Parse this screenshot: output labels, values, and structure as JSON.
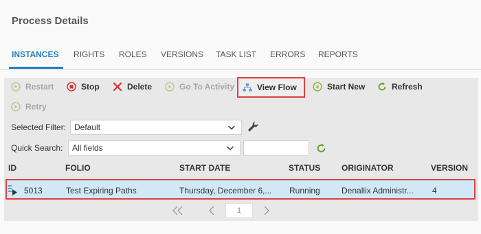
{
  "header": {
    "title": "Process Details"
  },
  "tabs": [
    {
      "label": "INSTANCES",
      "active": true
    },
    {
      "label": "RIGHTS"
    },
    {
      "label": "ROLES"
    },
    {
      "label": "VERSIONS"
    },
    {
      "label": "TASK LIST"
    },
    {
      "label": "ERRORS"
    },
    {
      "label": "REPORTS"
    }
  ],
  "toolbar": {
    "restart": "Restart",
    "stop": "Stop",
    "delete": "Delete",
    "goto_activity": "Go To Activity",
    "view_flow": "View Flow",
    "start_new": "Start New",
    "refresh": "Refresh",
    "retry": "Retry"
  },
  "filters": {
    "selected_filter_label": "Selected Filter:",
    "selected_filter_value": "Default",
    "quick_search_label": "Quick Search:",
    "quick_search_value": "All fields",
    "quick_search_text": ""
  },
  "table": {
    "columns": [
      "ID",
      "FOLIO",
      "START DATE",
      "STATUS",
      "ORIGINATOR",
      "VERSION"
    ],
    "rows": [
      {
        "id": "5013",
        "folio": "Test Expiring Paths",
        "start_date": "Thursday, December 6,...",
        "status": "Running",
        "originator": "Denallix Administr...",
        "version": "4"
      }
    ]
  },
  "pager": {
    "current_page": "1"
  },
  "colors": {
    "accent": "#1f7fc0",
    "highlight_border": "#e04040",
    "selected_row": "#cfe9f7",
    "play_green": "#8bb82e",
    "stop_red": "#d9302c"
  },
  "icons": {
    "restart": "play-circle-icon",
    "stop": "stop-circle-icon",
    "delete": "x-icon",
    "goto_activity": "play-circle-icon",
    "view_flow": "flow-diagram-icon",
    "start_new": "play-circle-icon",
    "refresh": "refresh-icon",
    "retry": "play-circle-icon",
    "filter_settings": "wrench-icon",
    "search_refresh": "refresh-icon",
    "row_status": "running-instance-icon",
    "first_page": "double-chevron-left-icon",
    "prev_page": "chevron-left-icon",
    "next_page": "chevron-right-icon"
  }
}
